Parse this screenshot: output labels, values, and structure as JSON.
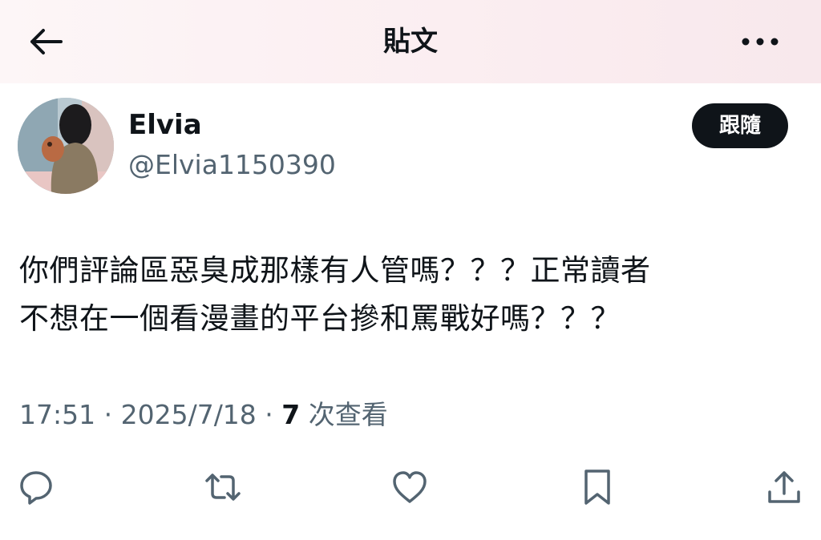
{
  "header": {
    "title": "貼文",
    "back_icon": "arrow-left-icon",
    "more_icon": "more-horizontal-icon"
  },
  "author": {
    "display_name": "Elvia",
    "handle": "@Elvia1150390",
    "follow_label": "跟隨"
  },
  "tweet": {
    "lines": [
      "你們評論區惡臭成那樣有人管嗎？？？正常讀者",
      "不想在一個看漫畫的平台摻和罵戰好嗎？？？"
    ]
  },
  "meta": {
    "time": "17:51",
    "separator": " · ",
    "date": "2025/7/18",
    "views_count": "7",
    "views_label": " 次查看"
  },
  "actions": {
    "reply_icon": "reply-icon",
    "retweet_icon": "retweet-icon",
    "like_icon": "heart-icon",
    "bookmark_icon": "bookmark-icon",
    "share_icon": "share-icon"
  },
  "colors": {
    "text": "#0f1419",
    "secondary": "#536471",
    "button_bg": "#0f1419",
    "header_tint": "#fbeef1"
  }
}
